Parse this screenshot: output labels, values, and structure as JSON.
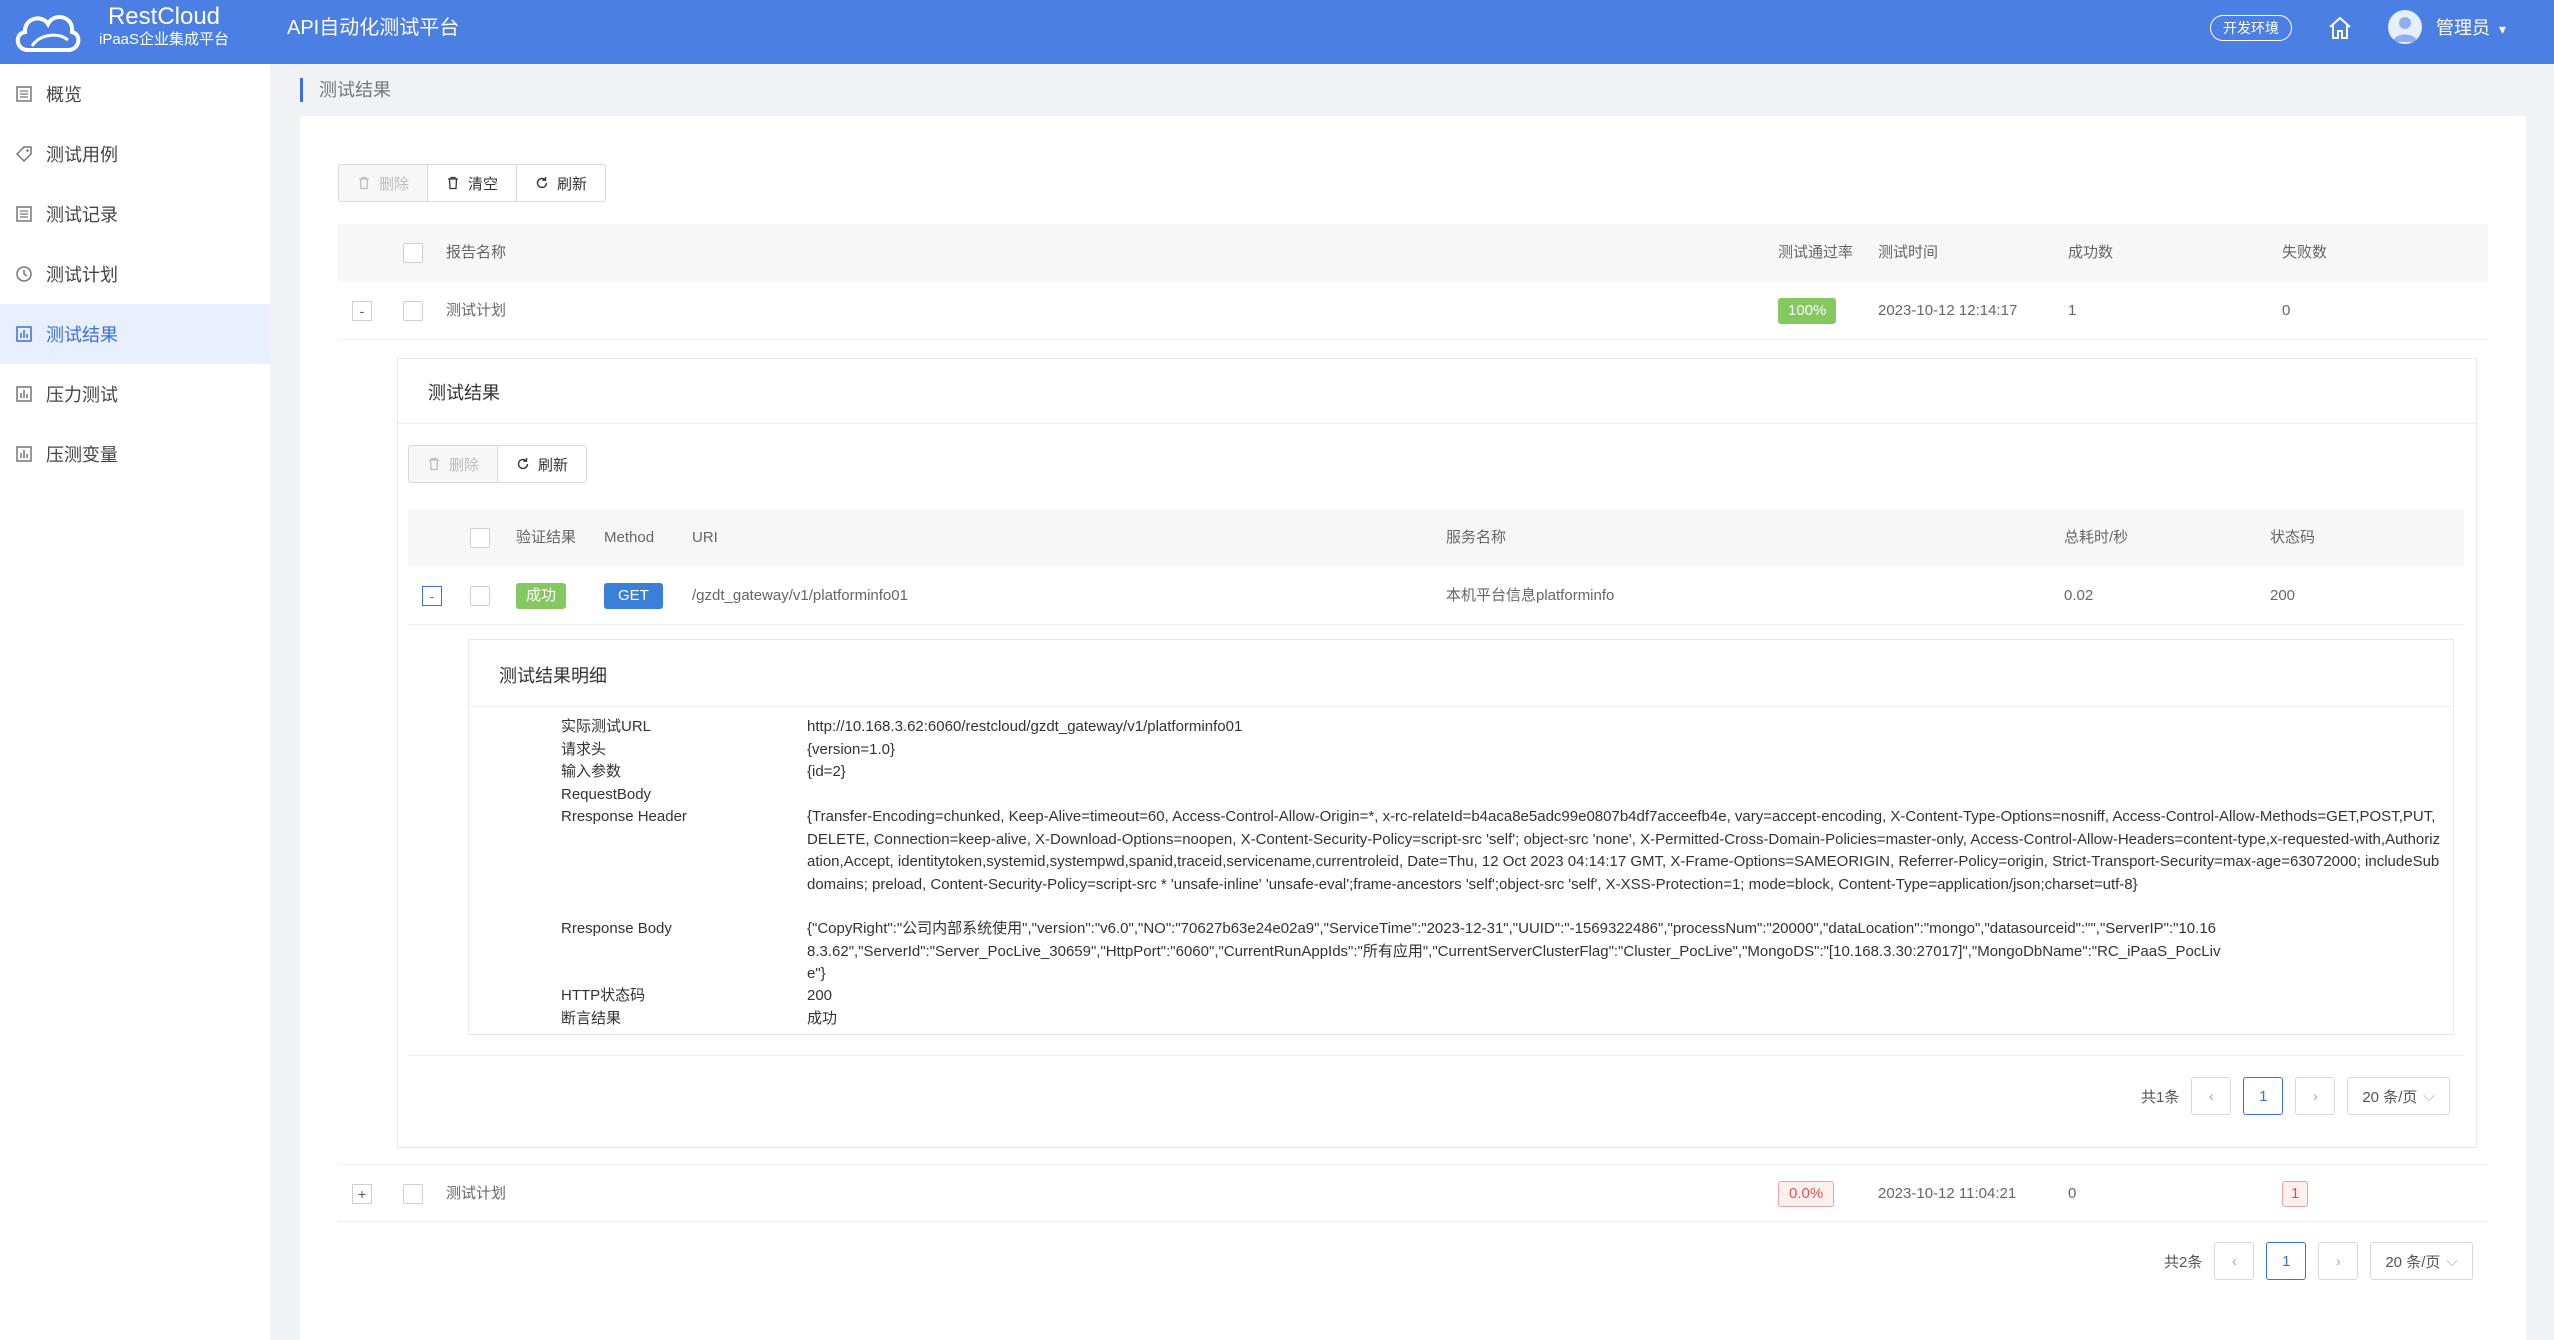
{
  "header": {
    "brand_name": "RestCloud",
    "brand_sub": "iPaaS企业集成平台",
    "app_title": "API自动化测试平台",
    "env_label": "开发环境",
    "user_name": "管理员",
    "user_caret": "▾",
    "accent": "#4c7fe4"
  },
  "sidebar": {
    "items": [
      {
        "label": "概览",
        "icon": "list-icon"
      },
      {
        "label": "测试用例",
        "icon": "tag-icon"
      },
      {
        "label": "测试记录",
        "icon": "list-icon"
      },
      {
        "label": "测试计划",
        "icon": "clock-icon"
      },
      {
        "label": "测试结果",
        "icon": "chart-icon",
        "active": true
      },
      {
        "label": "压力测试",
        "icon": "chart-icon"
      },
      {
        "label": "压测变量",
        "icon": "chart-icon"
      }
    ]
  },
  "breadcrumb": "测试结果",
  "toolbar": {
    "delete": "删除",
    "clear": "清空",
    "refresh": "刷新"
  },
  "table": {
    "headers": {
      "name": "报告名称",
      "pass_rate": "测试通过率",
      "time": "测试时间",
      "success": "成功数",
      "fail": "失败数"
    },
    "rows": [
      {
        "toggle": "-",
        "name": "测试计划",
        "pass_rate": "100%",
        "time": "2023-10-12 12:14:17",
        "success": "1",
        "fail": "0"
      },
      {
        "toggle": "+",
        "name": "测试计划",
        "pass_rate": "0.0%",
        "time": "2023-10-12 11:04:21",
        "success": "0",
        "fail": "1"
      }
    ]
  },
  "inner": {
    "title": "测试结果",
    "toolbar": {
      "delete": "删除",
      "refresh": "刷新"
    },
    "headers": {
      "verify": "验证结果",
      "method": "Method",
      "uri": "URI",
      "service": "服务名称",
      "duration": "总耗时/秒",
      "status": "状态码"
    },
    "row": {
      "toggle": "-",
      "verify": "成功",
      "method": "GET",
      "uri": "/gzdt_gateway/v1/platforminfo01",
      "service": "本机平台信息platforminfo",
      "duration": "0.02",
      "status": "200"
    },
    "pagination": {
      "total": "共1条",
      "page": "1",
      "size": "20 条/页"
    }
  },
  "detail": {
    "title": "测试结果明细",
    "items": [
      {
        "label": "实际测试URL",
        "value": "http://10.168.3.62:6060/restcloud/gzdt_gateway/v1/platforminfo01"
      },
      {
        "label": "请求头",
        "value": "{version=1.0}"
      },
      {
        "label": "输入参数",
        "value": "{id=2}"
      },
      {
        "label": "RequestBody",
        "value": ""
      },
      {
        "label": "Rresponse Header",
        "value": "{Transfer-Encoding=chunked, Keep-Alive=timeout=60, Access-Control-Allow-Origin=*, x-rc-relateId=b4aca8e5adc99e0807b4df7acceefb4e, vary=accept-encoding, X-Content-Type-Options=nosniff, Access-Control-Allow-Methods=GET,POST,PUT,DELETE, Connection=keep-alive, X-Download-Options=noopen, X-Content-Security-Policy=script-src 'self'; object-src 'none', X-Permitted-Cross-Domain-Policies=master-only, Access-Control-Allow-Headers=content-type,x-requested-with,Authorization,Accept, identitytoken,systemid,systempwd,spanid,traceid,servicename,currentroleid, Date=Thu, 12 Oct 2023 04:14:17 GMT, X-Frame-Options=SAMEORIGIN, Referrer-Policy=origin, Strict-Transport-Security=max-age=63072000; includeSubdomains; preload, Content-Security-Policy=script-src * 'unsafe-inline' 'unsafe-eval';frame-ancestors 'self';object-src 'self', X-XSS-Protection=1; mode=block, Content-Type=application/json;charset=utf-8}"
      },
      {
        "label": "Rresponse Body",
        "value": "{\"CopyRight\":\"公司内部系统使用\",\"version\":\"v6.0\",\"NO\":\"70627b63e24e02a9\",\"ServiceTime\":\"2023-12-31\",\"UUID\":\"-1569322486\",\"processNum\":\"20000\",\"dataLocation\":\"mongo\",\"datasourceid\":\"\",\"ServerIP\":\"10.168.3.62\",\"ServerId\":\"Server_PocLive_30659\",\"HttpPort\":\"6060\",\"CurrentRunAppIds\":\"所有应用\",\"CurrentServerClusterFlag\":\"Cluster_PocLive\",\"MongoDS\":\"[10.168.3.30:27017]\",\"MongoDbName\":\"RC_iPaaS_PocLive\"}"
      },
      {
        "label": "HTTP状态码",
        "value": "200"
      },
      {
        "label": "断言结果",
        "value": "成功"
      }
    ]
  },
  "pagination": {
    "total": "共2条",
    "page": "1",
    "size": "20 条/页"
  }
}
